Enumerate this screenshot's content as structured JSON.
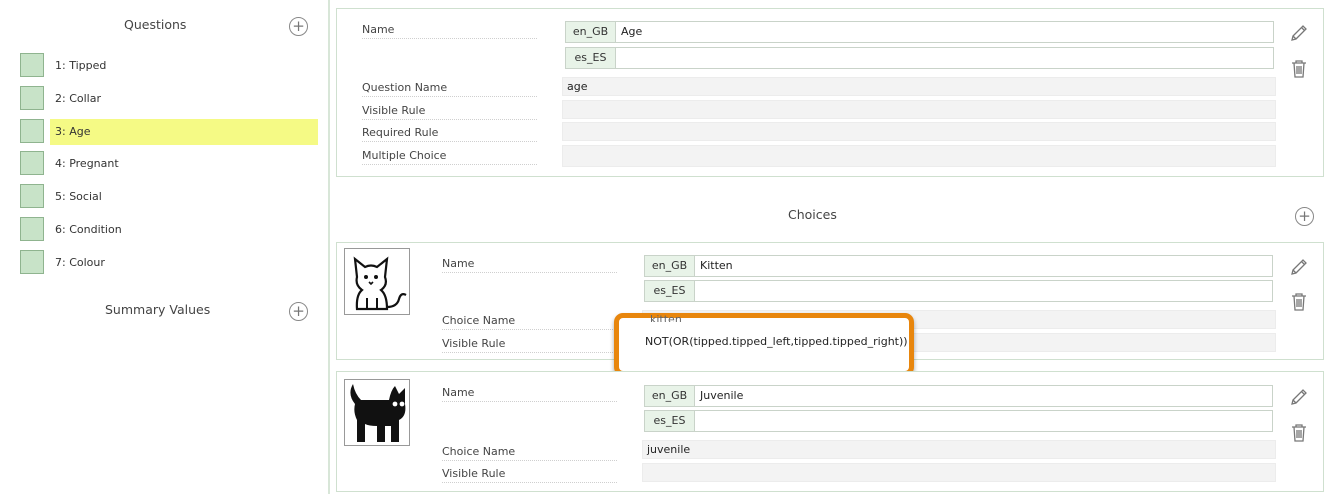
{
  "sidebar": {
    "questions_title": "Questions",
    "questions": [
      {
        "label": "1: Tipped"
      },
      {
        "label": "2: Collar"
      },
      {
        "label": "3: Age",
        "selected": true
      },
      {
        "label": "4: Pregnant"
      },
      {
        "label": "5: Social"
      },
      {
        "label": "6: Condition"
      },
      {
        "label": "7: Colour"
      }
    ],
    "summary_title": "Summary Values"
  },
  "question": {
    "name_label": "Name",
    "names": [
      {
        "lang": "en_GB",
        "value": "Age"
      },
      {
        "lang": "es_ES",
        "value": ""
      }
    ],
    "question_name_label": "Question Name",
    "question_name": "age",
    "visible_rule_label": "Visible Rule",
    "visible_rule": "",
    "required_rule_label": "Required Rule",
    "required_rule": "",
    "multiple_choice_label": "Multiple Choice",
    "multiple_choice": ""
  },
  "choices_title": "Choices",
  "choices": [
    {
      "image": "kitten-outline-icon",
      "name_label": "Name",
      "names": [
        {
          "lang": "en_GB",
          "value": "Kitten"
        },
        {
          "lang": "es_ES",
          "value": ""
        }
      ],
      "choice_name_label": "Choice Name",
      "choice_name": "kitten",
      "visible_rule_label": "Visible Rule",
      "visible_rule": "NOT(OR(tipped.tipped_left,tipped.tipped_right))"
    },
    {
      "image": "black-cat-icon",
      "name_label": "Name",
      "names": [
        {
          "lang": "en_GB",
          "value": "Juvenile"
        },
        {
          "lang": "es_ES",
          "value": ""
        }
      ],
      "choice_name_label": "Choice Name",
      "choice_name": "juvenile",
      "visible_rule_label": "Visible Rule",
      "visible_rule": ""
    }
  ],
  "colors": {
    "swatch": "#c8e3c8",
    "selected": "#f5fa85",
    "highlight": "#e8860d",
    "border": "#cfe0cf"
  }
}
